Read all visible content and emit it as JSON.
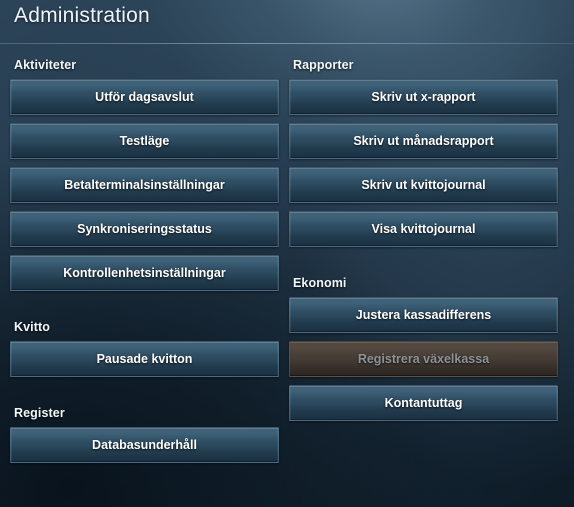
{
  "header": {
    "title": "Administration"
  },
  "columns": {
    "left": [
      {
        "id": "aktiviteter",
        "heading": "Aktiviteter",
        "buttons": [
          {
            "label": "Utför dagsavslut",
            "enabled": true
          },
          {
            "label": "Testläge",
            "enabled": true
          },
          {
            "label": "Betalterminalsinställningar",
            "enabled": true
          },
          {
            "label": "Synkroniseringsstatus",
            "enabled": true
          },
          {
            "label": "Kontrollenhetsinställningar",
            "enabled": true
          }
        ]
      },
      {
        "id": "kvitto",
        "heading": "Kvitto",
        "buttons": [
          {
            "label": "Pausade kvitton",
            "enabled": true
          }
        ]
      },
      {
        "id": "register",
        "heading": "Register",
        "buttons": [
          {
            "label": "Databasunderhåll",
            "enabled": true
          }
        ]
      }
    ],
    "right": [
      {
        "id": "rapporter",
        "heading": "Rapporter",
        "buttons": [
          {
            "label": "Skriv ut x-rapport",
            "enabled": true
          },
          {
            "label": "Skriv ut månadsrapport",
            "enabled": true
          },
          {
            "label": "Skriv ut kvittojournal",
            "enabled": true
          },
          {
            "label": "Visa kvittojournal",
            "enabled": true
          }
        ]
      },
      {
        "id": "ekonomi",
        "heading": "Ekonomi",
        "buttons": [
          {
            "label": "Justera kassadifferens",
            "enabled": true
          },
          {
            "label": "Registrera växelkassa",
            "enabled": false
          },
          {
            "label": "Kontantuttag",
            "enabled": true
          }
        ]
      }
    ]
  },
  "colors": {
    "background_top": "#2c4458",
    "background_bottom": "#132330",
    "button_face": "#2d4b60",
    "button_border": "#80a6c0",
    "text": "#ffffff",
    "disabled_face": "#463d35",
    "disabled_text": "#8d9299",
    "divider": "#aacde4"
  }
}
